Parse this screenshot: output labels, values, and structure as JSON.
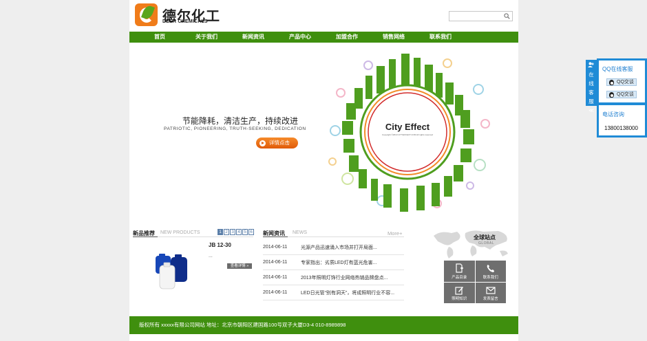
{
  "header": {
    "logo_cn": "德尔化工",
    "logo_en": "DEER CHEMICALS",
    "search_placeholder": ""
  },
  "nav": [
    "首页",
    "关于我们",
    "新闻资讯",
    "产品中心",
    "加盟合作",
    "销售网络",
    "联系我们"
  ],
  "banner": {
    "slogan_cn": "节能降耗，清洁生产，持续改进",
    "slogan_en": "PATRIOTIC, PIONEERING, TRUTH-SEEKING, DEDICATION",
    "button_label": "详情点击",
    "city_title": "City Effect",
    "city_copyright": "Copyright ©2013 CITYEFFECT.COM All rights reserved"
  },
  "products": {
    "title": "新品推荐",
    "subtitle": "NEW PRODUCTS",
    "pages": [
      "1",
      "2",
      "3",
      "4",
      "5",
      "6"
    ],
    "active_page": "1",
    "item_name": "JB 12-30",
    "item_desc": "...",
    "view_label": "查看详情 »"
  },
  "news": {
    "title": "新闻资讯",
    "subtitle": "NEWS",
    "more_label": "More+",
    "items": [
      {
        "date": "2014-06-11",
        "headline": "光源产品迅速涌入市场并打开局面..."
      },
      {
        "date": "2014-06-11",
        "headline": "专家指出：劣质LED灯有蓝光危害..."
      },
      {
        "date": "2014-06-11",
        "headline": "2013年照明灯饰行业网络热销品牌盘点..."
      },
      {
        "date": "2014-06-11",
        "headline": "LED日光管“别有洞天”，将成照明行业不容..."
      }
    ]
  },
  "global": {
    "title_cn": "全球站点",
    "title_en": "GLOBAL",
    "tiles": [
      {
        "label": "产品目录",
        "icon": "document-add-icon"
      },
      {
        "label": "联系我们",
        "icon": "phone-icon"
      },
      {
        "label": "照明知识",
        "icon": "edit-icon"
      },
      {
        "label": "发表留言",
        "icon": "envelope-icon"
      }
    ]
  },
  "footer": {
    "text": "版权所有 xxxxx有限公司网站 地址：北京市朝阳区建国路100号双子大厦D3-4 010-8989898"
  },
  "side_widget": {
    "tab_label": [
      "在",
      "线",
      "客",
      "服"
    ],
    "tab_arrow": "≪",
    "qq_title": "QQ在线客服",
    "qq_buttons": [
      "QQ交谈",
      "QQ交谈"
    ],
    "phone_title": "电话咨询",
    "phone_number": "13800138000"
  },
  "colors": {
    "nav_green": "#3f8f0e",
    "accent_orange": "#e05a09",
    "side_blue": "#1f8bd6"
  }
}
